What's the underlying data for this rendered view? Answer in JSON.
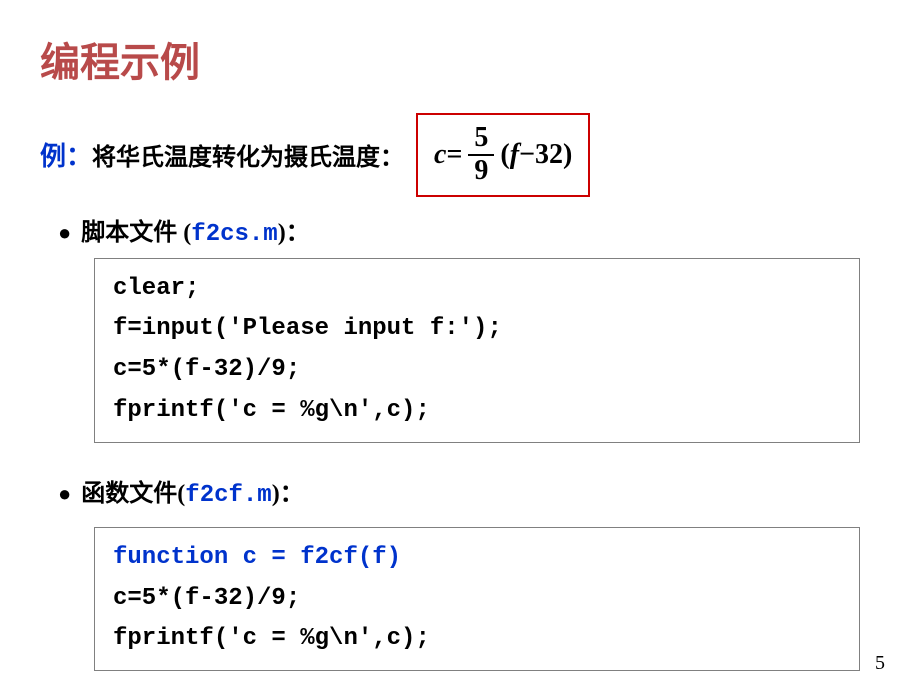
{
  "title": "编程示例",
  "example": {
    "label": "例：",
    "text": "将华氏温度转化为摄氏温度：",
    "formula": {
      "lhs": "c",
      "eq": " = ",
      "num": "5",
      "den": "9",
      "rhs_open": "(",
      "rhs_var": " f ",
      "rhs_minus": "− ",
      "rhs_const": "32",
      "rhs_close": ")"
    }
  },
  "section1": {
    "label_pre": "脚本文件 (",
    "filename": "f2cs.m",
    "label_post": ")：",
    "code": [
      "clear;",
      "f=input('Please input f:');",
      "c=5*(f-32)/9;",
      "fprintf('c = %g\\n',c);"
    ]
  },
  "section2": {
    "label_pre": "函数文件(",
    "filename": "f2cf.m",
    "label_post": ")：",
    "code_first": "function c = f2cf(f)",
    "code_rest": [
      "c=5*(f-32)/9;",
      "fprintf('c = %g\\n',c);"
    ]
  },
  "page_number": "5"
}
